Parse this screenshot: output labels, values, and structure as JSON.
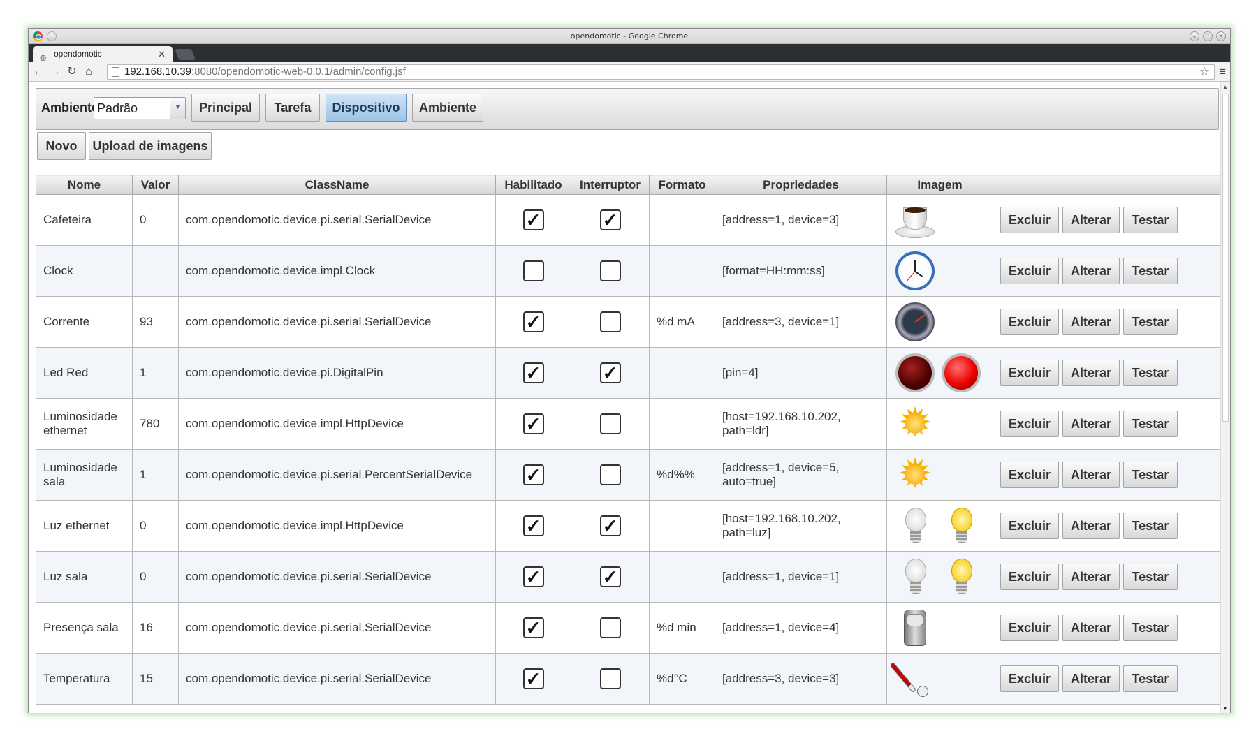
{
  "window": {
    "title": "opendomotic - Google Chrome",
    "tab_title": "opendomotic",
    "url_host": "192.168.10.39",
    "url_rest": ":8080/opendomotic-web-0.0.1/admin/config.jsf"
  },
  "menubar": {
    "ambiente_label": "Ambiente",
    "ambiente_value": "Padrão",
    "buttons": [
      "Principal",
      "Tarefa",
      "Dispositivo",
      "Ambiente"
    ],
    "active": "Dispositivo"
  },
  "actions": {
    "novo": "Novo",
    "upload": "Upload de imagens"
  },
  "table": {
    "columns": [
      "Nome",
      "Valor",
      "ClassName",
      "Habilitado",
      "Interruptor",
      "Formato",
      "Propriedades",
      "Imagem",
      ""
    ],
    "row_buttons": [
      "Excluir",
      "Alterar",
      "Testar"
    ],
    "rows": [
      {
        "nome": "Cafeteira",
        "valor": "0",
        "classname": "com.opendomotic.device.pi.serial.SerialDevice",
        "habilitado": true,
        "interruptor": true,
        "formato": "",
        "propriedades": "[address=1, device=3]",
        "imagem": [
          "cup-icon"
        ]
      },
      {
        "nome": "Clock",
        "valor": "",
        "classname": "com.opendomotic.device.impl.Clock",
        "habilitado": false,
        "interruptor": false,
        "formato": "",
        "propriedades": "[format=HH:mm:ss]",
        "imagem": [
          "clock-icon"
        ]
      },
      {
        "nome": "Corrente",
        "valor": "93",
        "classname": "com.opendomotic.device.pi.serial.SerialDevice",
        "habilitado": true,
        "interruptor": false,
        "formato": "%d mA",
        "propriedades": "[address=3, device=1]",
        "imagem": [
          "gauge-icon"
        ]
      },
      {
        "nome": "Led Red",
        "valor": "1",
        "classname": "com.opendomotic.device.pi.DigitalPin",
        "habilitado": true,
        "interruptor": true,
        "formato": "",
        "propriedades": "[pin=4]",
        "imagem": [
          "led-off-icon",
          "led-on-icon"
        ]
      },
      {
        "nome": "Luminosidade ethernet",
        "valor": "780",
        "classname": "com.opendomotic.device.impl.HttpDevice",
        "habilitado": true,
        "interruptor": false,
        "formato": "",
        "propriedades": "[host=192.168.10.202, path=ldr]",
        "imagem": [
          "sun-icon"
        ]
      },
      {
        "nome": "Luminosidade sala",
        "valor": "1",
        "classname": "com.opendomotic.device.pi.serial.PercentSerialDevice",
        "habilitado": true,
        "interruptor": false,
        "formato": "%d%%",
        "propriedades": "[address=1, device=5, auto=true]",
        "imagem": [
          "sun-icon"
        ]
      },
      {
        "nome": "Luz ethernet",
        "valor": "0",
        "classname": "com.opendomotic.device.impl.HttpDevice",
        "habilitado": true,
        "interruptor": true,
        "formato": "",
        "propriedades": "[host=192.168.10.202, path=luz]",
        "imagem": [
          "bulb-off-icon",
          "bulb-on-icon"
        ]
      },
      {
        "nome": "Luz sala",
        "valor": "0",
        "classname": "com.opendomotic.device.pi.serial.SerialDevice",
        "habilitado": true,
        "interruptor": true,
        "formato": "",
        "propriedades": "[address=1, device=1]",
        "imagem": [
          "bulb-off-icon",
          "bulb-on-icon"
        ]
      },
      {
        "nome": "Presença sala",
        "valor": "16",
        "classname": "com.opendomotic.device.pi.serial.SerialDevice",
        "habilitado": true,
        "interruptor": false,
        "formato": "%d min",
        "propriedades": "[address=1, device=4]",
        "imagem": [
          "motion-sensor-icon"
        ]
      },
      {
        "nome": "Temperatura",
        "valor": "15",
        "classname": "com.opendomotic.device.pi.serial.SerialDevice",
        "habilitado": true,
        "interruptor": false,
        "formato": "%d°C",
        "propriedades": "[address=3, device=3]",
        "imagem": [
          "thermometer-icon"
        ]
      }
    ]
  }
}
